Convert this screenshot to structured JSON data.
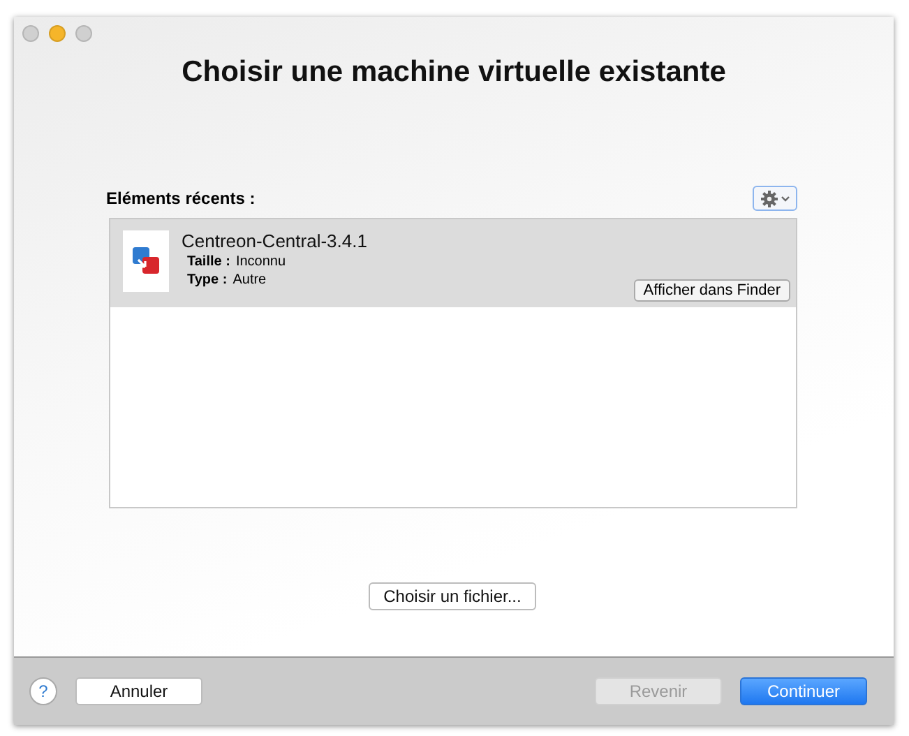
{
  "window": {
    "title": "Choisir une machine virtuelle existante",
    "lights": [
      {
        "color": "#d0d0d0"
      },
      {
        "color": "#f5b52a"
      },
      {
        "color": "#d0d0d0"
      }
    ]
  },
  "recent": {
    "label": "Eléments récents :",
    "items": [
      {
        "name": "Centreon-Central-3.4.1",
        "size_label": "Taille :",
        "size": "Inconnu",
        "type_label": "Type :",
        "type": "Autre",
        "reveal_button": "Afficher dans Finder",
        "selected": true
      }
    ]
  },
  "choose_file_button": "Choisir un fichier...",
  "footer": {
    "help": "?",
    "buttons": [
      {
        "label": "Annuler",
        "kind": "plain",
        "disabled": false
      },
      {
        "label": "Revenir",
        "kind": "plain",
        "disabled": true
      },
      {
        "label": "Continuer",
        "kind": "default",
        "disabled": false
      }
    ]
  }
}
